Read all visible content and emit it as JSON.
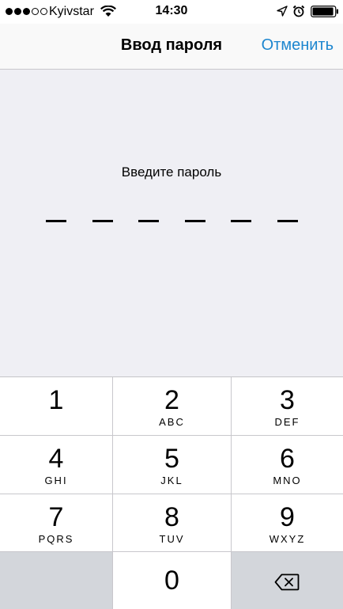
{
  "status_bar": {
    "carrier": "Kyivstar",
    "time": "14:30",
    "signal": {
      "filled": 3,
      "total": 5
    },
    "battery_level": 0.95,
    "icons": [
      "wifi-icon",
      "location-icon",
      "alarm-icon",
      "battery-icon"
    ]
  },
  "nav": {
    "title": "Ввод пароля",
    "cancel_label": "Отменить",
    "accent_color": "#1d86cf"
  },
  "passcode": {
    "prompt": "Введите пароль",
    "length": 6,
    "entered": 0
  },
  "keypad": {
    "keys": [
      {
        "digit": "1",
        "letters": ""
      },
      {
        "digit": "2",
        "letters": "ABC"
      },
      {
        "digit": "3",
        "letters": "DEF"
      },
      {
        "digit": "4",
        "letters": "GHI"
      },
      {
        "digit": "5",
        "letters": "JKL"
      },
      {
        "digit": "6",
        "letters": "MNO"
      },
      {
        "digit": "7",
        "letters": "PQRS"
      },
      {
        "digit": "8",
        "letters": "TUV"
      },
      {
        "digit": "9",
        "letters": "WXYZ"
      }
    ],
    "zero": {
      "digit": "0"
    },
    "delete_icon": "delete-backspace-icon"
  }
}
